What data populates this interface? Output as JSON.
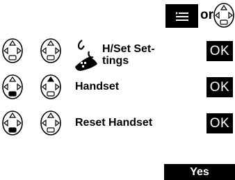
{
  "header": {
    "or_label": "or"
  },
  "rows": [
    {
      "label_line1": "H/Set Set-",
      "label_line2": "tings",
      "ok_label": "OK"
    },
    {
      "label": "Handset",
      "ok_label": "OK"
    },
    {
      "label": "Reset Handset",
      "ok_label": "OK"
    }
  ],
  "softkey": {
    "yes_label": "Yes"
  },
  "icons": [
    "menu-key-icon",
    "navigation-key-icon",
    "handset-icon"
  ],
  "colors": {
    "key_background": "#000000",
    "key_text": "#ffffff",
    "page_background": "#ffffff"
  }
}
